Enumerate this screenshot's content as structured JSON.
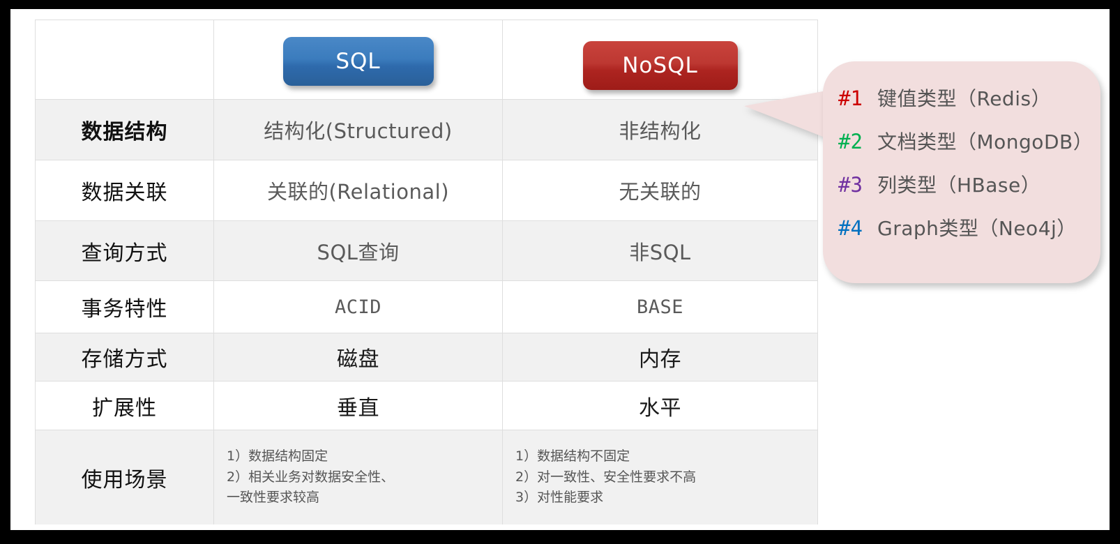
{
  "frame": {
    "border_color": "#000000",
    "canvas_color": "#ffffff"
  },
  "table": {
    "header": {
      "corner_label": "",
      "sql_label": "SQL",
      "nosql_label": "NoSQL",
      "sql_color": "#3b7cbd",
      "nosql_color": "#bd3832"
    },
    "columns": [
      "",
      "SQL",
      "NoSQL"
    ],
    "rows": [
      {
        "label": "数据结构",
        "sql": "结构化(Structured)",
        "nosql": "非结构化",
        "bold_label": true,
        "shaded": true
      },
      {
        "label": "数据关联",
        "sql": "关联的(Relational)",
        "nosql": "无关联的",
        "bold_label": false,
        "shaded": false
      },
      {
        "label": "查询方式",
        "sql": "SQL查询",
        "nosql": "非SQL",
        "bold_label": false,
        "shaded": true
      },
      {
        "label": "事务特性",
        "sql": "ACID",
        "nosql": "BASE",
        "bold_label": false,
        "shaded": false
      },
      {
        "label": "存储方式",
        "sql": "磁盘",
        "nosql": "内存",
        "bold_label": false,
        "shaded": true
      },
      {
        "label": "扩展性",
        "sql": "垂直",
        "nosql": "水平",
        "bold_label": false,
        "shaded": false
      },
      {
        "label": "使用场景",
        "sql": "1）数据结构固定\n2）相关业务对数据安全性、\n一致性要求较高",
        "nosql": "1）数据结构不固定\n2）对一致性、安全性要求不高\n3）对性能要求",
        "bold_label": false,
        "shaded": true
      }
    ]
  },
  "callout": {
    "background": "#f2dede",
    "items": [
      {
        "num": "#1",
        "text": "键值类型（Redis）",
        "color": "#cc0000"
      },
      {
        "num": "#2",
        "text": "文档类型（MongoDB）",
        "color": "#00b050"
      },
      {
        "num": "#3",
        "text": "列类型（HBase）",
        "color": "#7030a0"
      },
      {
        "num": "#4",
        "text": "Graph类型（Neo4j）",
        "color": "#0070c0"
      }
    ]
  }
}
